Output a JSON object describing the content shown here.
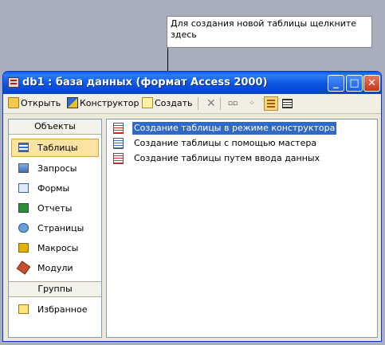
{
  "callout": {
    "text": "Для создания новой таблицы щелкните здесь"
  },
  "window": {
    "title": "db1 : база данных (формат Access 2000)",
    "buttons": {
      "minimize": "_",
      "maximize": "□",
      "close": "✕"
    }
  },
  "toolbar": {
    "open_label": "Открыть",
    "design_label": "Конструктор",
    "create_label": "Создать",
    "delete_icon": "✕"
  },
  "objects_panel": {
    "header": "Объекты",
    "items": [
      {
        "label": "Таблицы",
        "icon": "table-icon"
      },
      {
        "label": "Запросы",
        "icon": "query-icon"
      },
      {
        "label": "Формы",
        "icon": "form-icon"
      },
      {
        "label": "Отчеты",
        "icon": "report-icon"
      },
      {
        "label": "Страницы",
        "icon": "page-icon"
      },
      {
        "label": "Макросы",
        "icon": "macro-icon"
      },
      {
        "label": "Модули",
        "icon": "module-icon"
      }
    ],
    "selected": "Таблицы",
    "groups_header": "Группы",
    "groups": [
      {
        "label": "Избранное",
        "icon": "favorites-icon"
      }
    ]
  },
  "list": {
    "items": [
      "Создание таблицы в режиме конструктора",
      "Создание таблицы с помощью мастера",
      "Создание таблицы путем ввода данных"
    ],
    "selected": "Создание таблицы в режиме конструктора"
  },
  "colors": {
    "titlebar": "#0a5ae8",
    "selection": "#316ac5",
    "background": "#a9aebc"
  }
}
